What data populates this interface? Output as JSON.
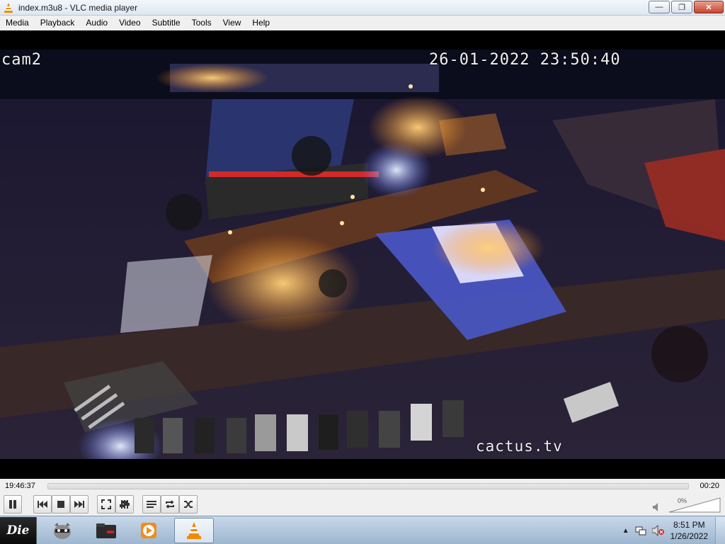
{
  "window": {
    "title": "index.m3u8 - VLC media player",
    "minimize_glyph": "—",
    "maximize_glyph": "❐",
    "close_glyph": "✕"
  },
  "menu": {
    "items": [
      "Media",
      "Playback",
      "Audio",
      "Video",
      "Subtitle",
      "Tools",
      "View",
      "Help"
    ]
  },
  "video": {
    "camera_label": "cam2",
    "timestamp": "26-01-2022 23:50:40",
    "watermark": "cactus.tv"
  },
  "seek": {
    "elapsed": "19:46:37",
    "remaining": "00:20",
    "progress": 0.0
  },
  "controls": {
    "volume_percent_text": "0%",
    "buttons": [
      "pause",
      "previous",
      "stop",
      "next",
      "fullscreen",
      "extended-settings",
      "playlist",
      "loop",
      "shuffle"
    ]
  },
  "taskbar": {
    "start_label": "Die",
    "clock_time": "8:51 PM",
    "clock_date": "1/26/2022"
  },
  "colors": {
    "vlc_orange": "#f08a00",
    "menubar_bg": "#f0f0f0",
    "taskbar_bg": "#a9c0d6"
  }
}
